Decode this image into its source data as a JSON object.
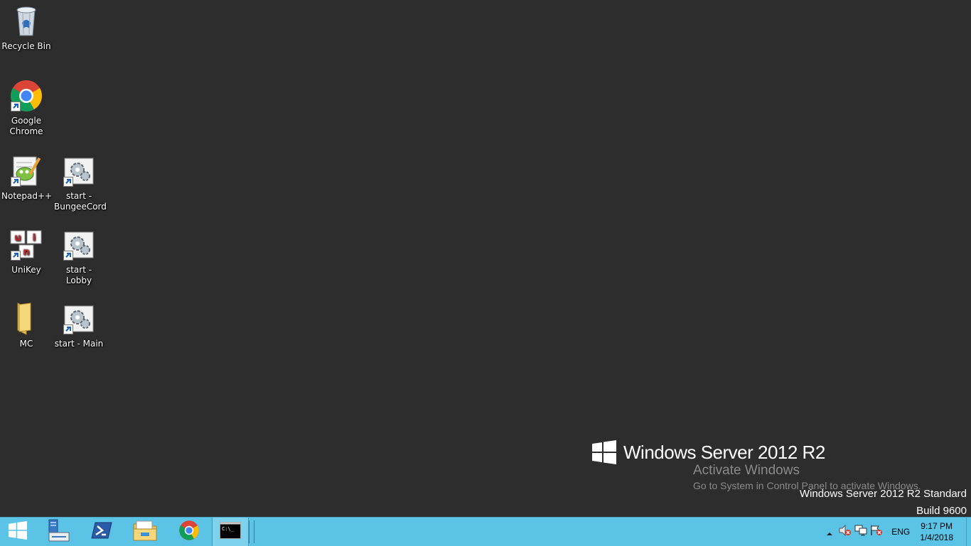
{
  "desktop": {
    "icons": [
      {
        "label": "Recycle Bin"
      },
      {
        "label": "Google Chrome"
      },
      {
        "label": "Notepad++"
      },
      {
        "label": "start - BungeeCord"
      },
      {
        "label": "UniKey"
      },
      {
        "label": "start - Lobby"
      },
      {
        "label": "MC"
      },
      {
        "label": "start - Main"
      }
    ]
  },
  "branding": {
    "product": "Windows Server 2012 R2",
    "activate_title": "Activate Windows",
    "activate_subtitle": "Go to System in Control Panel to activate Windows.",
    "edition": "Windows Server 2012 R2 Standard",
    "build": "Build 9600"
  },
  "taskbar": {
    "buttons": [
      {
        "icon": "windows-logo-icon"
      },
      {
        "icon": "server-manager-icon"
      },
      {
        "icon": "powershell-icon"
      },
      {
        "icon": "file-explorer-icon"
      },
      {
        "icon": "chrome-icon"
      },
      {
        "icon": "command-prompt-icon"
      }
    ],
    "tray": {
      "language": "ENG",
      "time": "9:17 PM",
      "date": "1/4/2018"
    }
  },
  "colors": {
    "desktop_bg": "#2d2d2d",
    "taskbar_bg": "#5bc3e6",
    "text_white": "#ffffff",
    "watermark_gray": "#8a8a8a"
  }
}
